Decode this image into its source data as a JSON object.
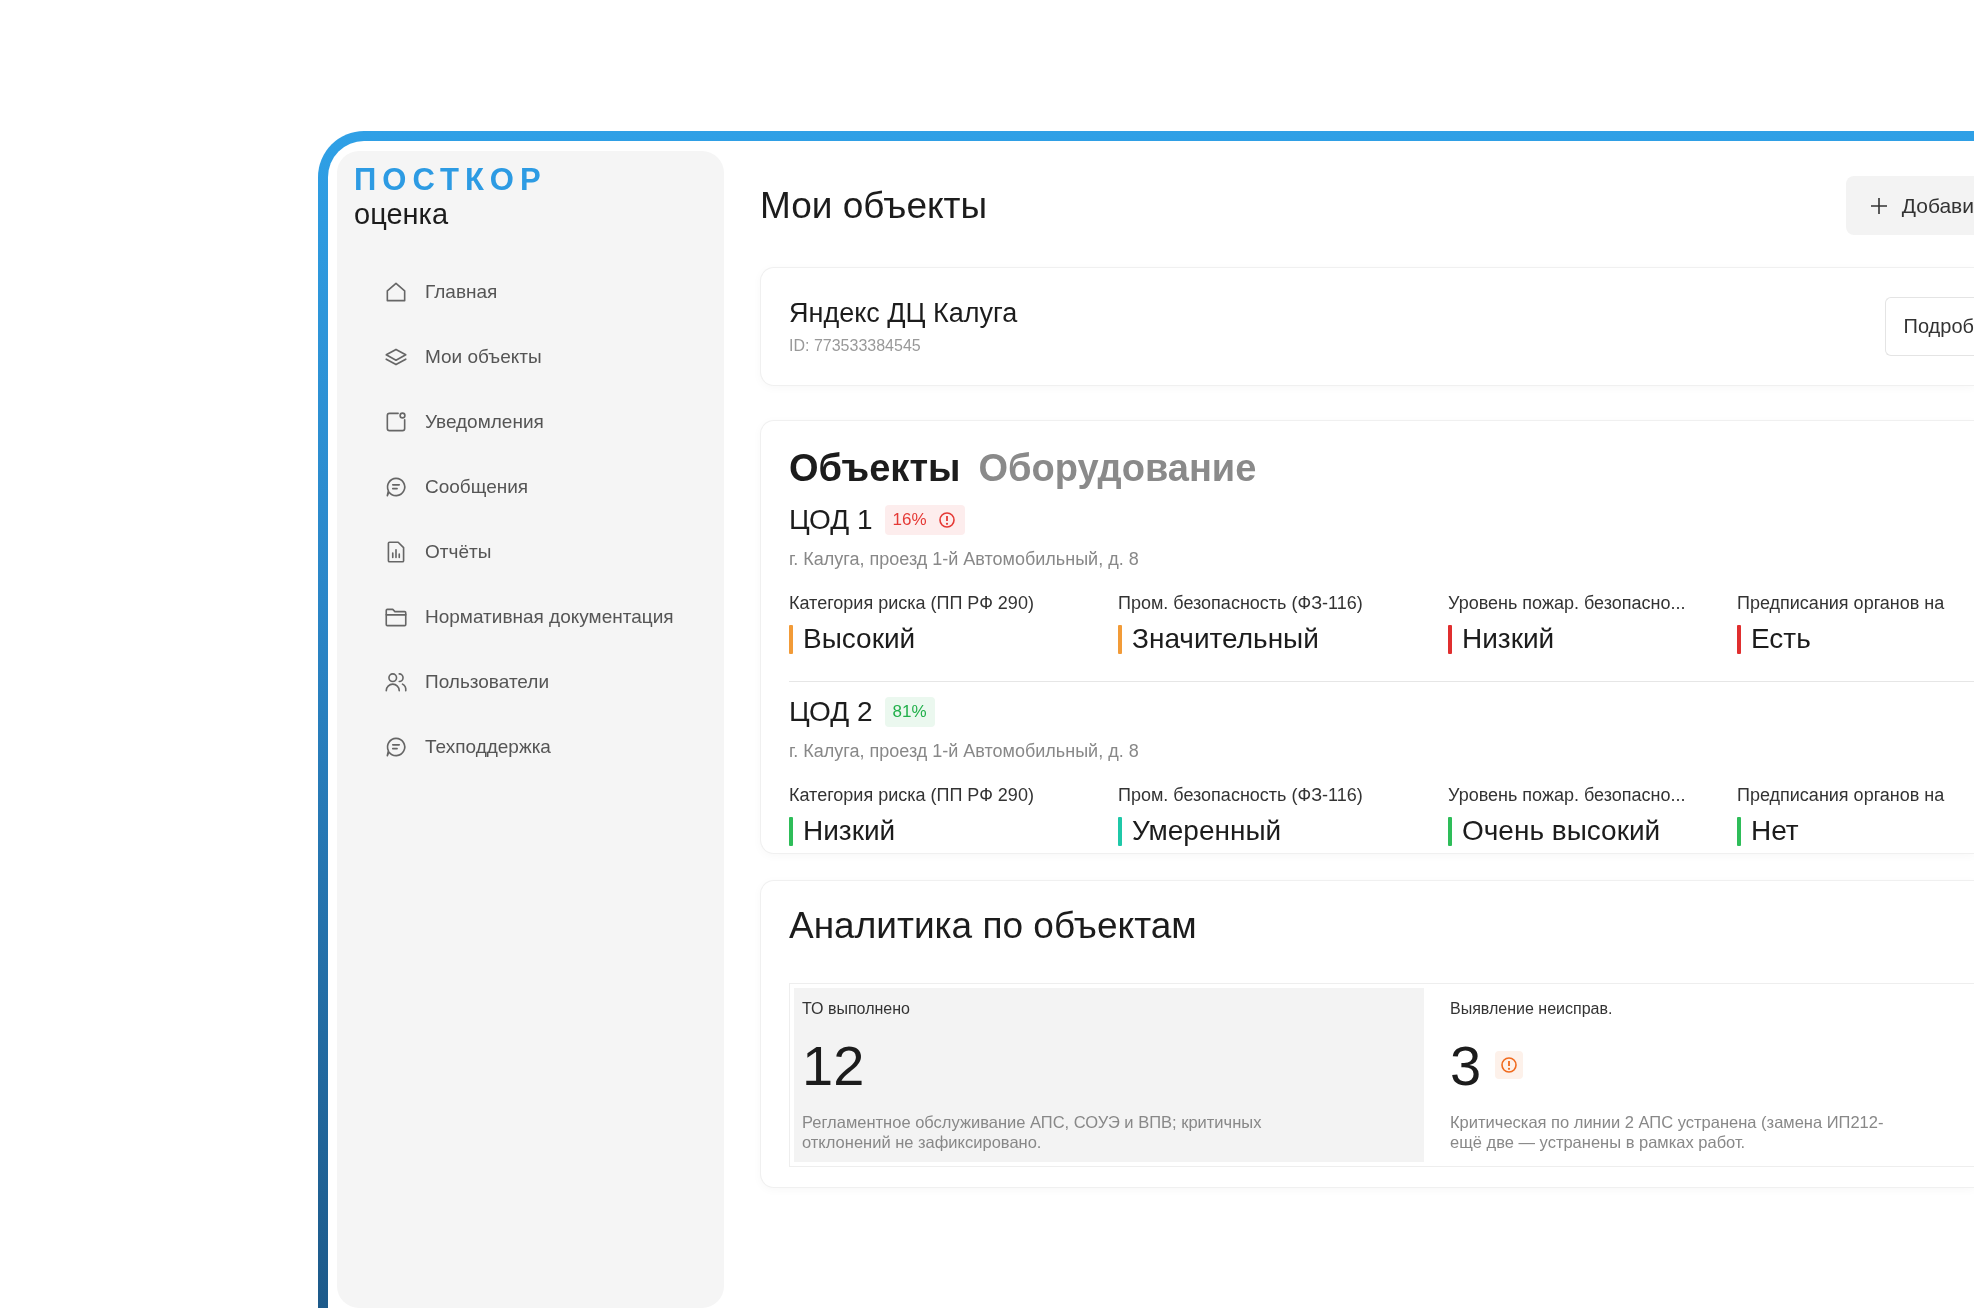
{
  "logo": {
    "brand": "ПОСТКОР",
    "product": "оценка"
  },
  "sidebar": {
    "items": [
      {
        "label": "Главная"
      },
      {
        "label": "Мои объекты"
      },
      {
        "label": "Уведомления"
      },
      {
        "label": "Сообщения"
      },
      {
        "label": "Отчёты"
      },
      {
        "label": "Нормативная документация"
      },
      {
        "label": "Пользователи"
      },
      {
        "label": "Техподдержка"
      }
    ]
  },
  "page_title": "Мои объекты",
  "add_button": "Добави",
  "site": {
    "name": "Яндекс ДЦ Калуга",
    "id": "ID: 773533384545",
    "details_button": "Подроб"
  },
  "tabs": [
    {
      "label": "Объекты",
      "selected": true
    },
    {
      "label": "Оборудование",
      "selected": false
    }
  ],
  "objects": [
    {
      "name": "ЦОД 1",
      "score": "16%",
      "color": "#e53935",
      "alert": true,
      "address": "г. Калуга, проезд 1-й Автомобильный, д. 8",
      "metrics": [
        {
          "label": "Категория риска (ПП РФ 290)",
          "value": "Высокий",
          "color": "#f29b38"
        },
        {
          "label": "Пром. безопасность (ФЗ-116)",
          "value": "Значительный",
          "color": "#f29b38"
        },
        {
          "label": "Уровень пожар. безопасно...",
          "value": "Низкий",
          "color": "#e02f2f"
        },
        {
          "label": "Предписания органов на",
          "value": "Есть",
          "color": "#e02f2f"
        }
      ]
    },
    {
      "name": "ЦОД 2",
      "score": "81%",
      "color": "#22b04b",
      "alert": false,
      "address": "г. Калуга, проезд 1-й Автомобильный, д. 8",
      "metrics": [
        {
          "label": "Категория риска (ПП РФ 290)",
          "value": "Низкий",
          "color": "#2ebd59"
        },
        {
          "label": "Пром. безопасность (ФЗ-116)",
          "value": "Умеренный",
          "color": "#1fc8a8"
        },
        {
          "label": "Уровень пожар. безопасно...",
          "value": "Очень высокий",
          "color": "#2ebd59"
        },
        {
          "label": "Предписания органов на",
          "value": "Нет",
          "color": "#2ebd59"
        }
      ]
    }
  ],
  "analytics": {
    "title": "Аналитика по объектам",
    "stats": [
      {
        "label": "ТО выполнено",
        "value": "12",
        "alert": false,
        "selected": true,
        "lines": [
          "Регламентное обслуживание АПС, СОУЭ и ВПВ; критичных",
          "отклонений не зафиксировано."
        ]
      },
      {
        "label": "Выявление неисправ.",
        "value": "3",
        "alert": true,
        "selected": false,
        "lines": [
          "Критическая по линии 2 АПС устранена (замена ИП212-",
          "ещё две — устранены в рамках работ."
        ]
      }
    ]
  }
}
